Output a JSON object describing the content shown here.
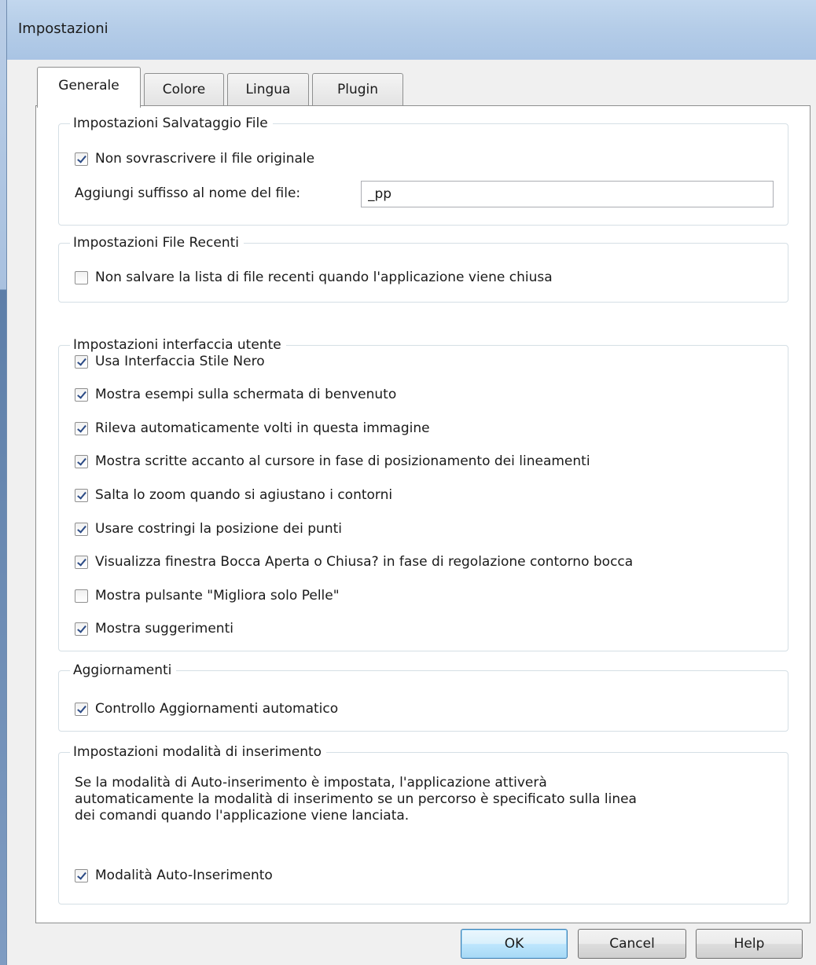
{
  "window": {
    "title": "Impostazioni"
  },
  "tabs": [
    {
      "label": "Generale",
      "active": true
    },
    {
      "label": "Colore",
      "active": false
    },
    {
      "label": "Lingua",
      "active": false
    },
    {
      "label": "Plugin",
      "active": false
    }
  ],
  "groups": {
    "file_save": {
      "title": "Impostazioni Salvataggio File",
      "no_overwrite": {
        "label": "Non sovrascrivere il file originale",
        "checked": true
      },
      "suffix_label": "Aggiungi suffisso al nome del file:",
      "suffix_value": "_pp"
    },
    "recent_files": {
      "title": "Impostazioni File Recenti",
      "no_save_recent": {
        "label": "Non salvare la lista di file recenti quando l'applicazione viene chiusa",
        "checked": false
      }
    },
    "ui": {
      "title": "Impostazioni interfaccia utente",
      "options": [
        {
          "label": "Usa Interfaccia Stile Nero",
          "checked": true
        },
        {
          "label": "Mostra esempi sulla schermata di benvenuto",
          "checked": true
        },
        {
          "label": "Rileva automaticamente volti in questa immagine",
          "checked": true
        },
        {
          "label": "Mostra scritte accanto al cursore in fase di posizionamento dei lineamenti",
          "checked": true
        },
        {
          "label": "Salta lo zoom quando si agiustano i contorni",
          "checked": true
        },
        {
          "label": "Usare costringi la posizione dei punti",
          "checked": true
        },
        {
          "label": "Visualizza finestra Bocca Aperta o Chiusa? in fase di regolazione contorno bocca",
          "checked": true
        },
        {
          "label": "Mostra pulsante \"Migliora solo Pelle\"",
          "checked": false
        },
        {
          "label": "Mostra suggerimenti",
          "checked": true
        }
      ]
    },
    "updates": {
      "title": "Aggiornamenti",
      "auto_check": {
        "label": "Controllo Aggiornamenti automatico",
        "checked": true
      }
    },
    "insert_mode": {
      "title": "Impostazioni modalità di inserimento",
      "description_lines": [
        "Se la modalità di Auto-inserimento è impostata, l'applicazione attiverà",
        "automaticamente la modalità di inserimento se un percorso è specificato sulla linea",
        "dei comandi quando l'applicazione viene lanciata."
      ],
      "auto_insert": {
        "label": "Modalità Auto-Inserimento",
        "checked": true
      }
    }
  },
  "buttons": {
    "ok": "OK",
    "cancel": "Cancel",
    "help": "Help"
  },
  "icons": {
    "checkbox_checked": "checkmark-icon"
  }
}
